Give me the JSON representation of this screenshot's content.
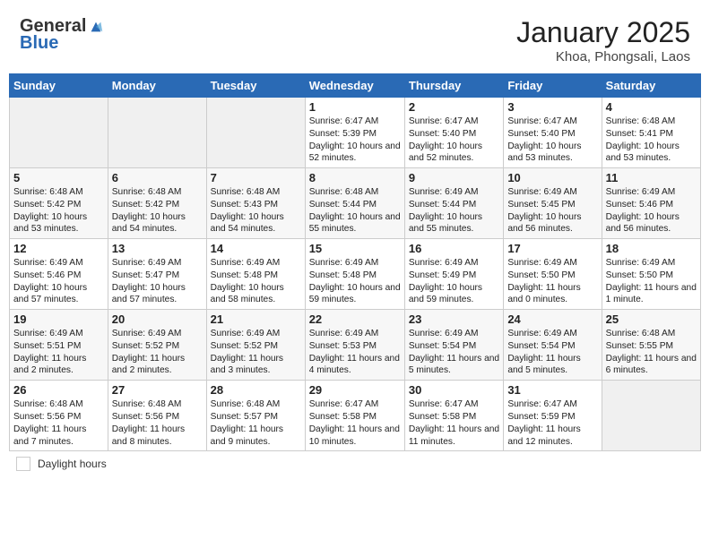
{
  "header": {
    "logo_general": "General",
    "logo_blue": "Blue",
    "month_title": "January 2025",
    "location": "Khoa, Phongsali, Laos"
  },
  "weekdays": [
    "Sunday",
    "Monday",
    "Tuesday",
    "Wednesday",
    "Thursday",
    "Friday",
    "Saturday"
  ],
  "weeks": [
    [
      {
        "day": "",
        "sunrise": "",
        "sunset": "",
        "daylight": "",
        "empty": true
      },
      {
        "day": "",
        "sunrise": "",
        "sunset": "",
        "daylight": "",
        "empty": true
      },
      {
        "day": "",
        "sunrise": "",
        "sunset": "",
        "daylight": "",
        "empty": true
      },
      {
        "day": "1",
        "sunrise": "Sunrise: 6:47 AM",
        "sunset": "Sunset: 5:39 PM",
        "daylight": "Daylight: 10 hours and 52 minutes."
      },
      {
        "day": "2",
        "sunrise": "Sunrise: 6:47 AM",
        "sunset": "Sunset: 5:40 PM",
        "daylight": "Daylight: 10 hours and 52 minutes."
      },
      {
        "day": "3",
        "sunrise": "Sunrise: 6:47 AM",
        "sunset": "Sunset: 5:40 PM",
        "daylight": "Daylight: 10 hours and 53 minutes."
      },
      {
        "day": "4",
        "sunrise": "Sunrise: 6:48 AM",
        "sunset": "Sunset: 5:41 PM",
        "daylight": "Daylight: 10 hours and 53 minutes."
      }
    ],
    [
      {
        "day": "5",
        "sunrise": "Sunrise: 6:48 AM",
        "sunset": "Sunset: 5:42 PM",
        "daylight": "Daylight: 10 hours and 53 minutes."
      },
      {
        "day": "6",
        "sunrise": "Sunrise: 6:48 AM",
        "sunset": "Sunset: 5:42 PM",
        "daylight": "Daylight: 10 hours and 54 minutes."
      },
      {
        "day": "7",
        "sunrise": "Sunrise: 6:48 AM",
        "sunset": "Sunset: 5:43 PM",
        "daylight": "Daylight: 10 hours and 54 minutes."
      },
      {
        "day": "8",
        "sunrise": "Sunrise: 6:48 AM",
        "sunset": "Sunset: 5:44 PM",
        "daylight": "Daylight: 10 hours and 55 minutes."
      },
      {
        "day": "9",
        "sunrise": "Sunrise: 6:49 AM",
        "sunset": "Sunset: 5:44 PM",
        "daylight": "Daylight: 10 hours and 55 minutes."
      },
      {
        "day": "10",
        "sunrise": "Sunrise: 6:49 AM",
        "sunset": "Sunset: 5:45 PM",
        "daylight": "Daylight: 10 hours and 56 minutes."
      },
      {
        "day": "11",
        "sunrise": "Sunrise: 6:49 AM",
        "sunset": "Sunset: 5:46 PM",
        "daylight": "Daylight: 10 hours and 56 minutes."
      }
    ],
    [
      {
        "day": "12",
        "sunrise": "Sunrise: 6:49 AM",
        "sunset": "Sunset: 5:46 PM",
        "daylight": "Daylight: 10 hours and 57 minutes."
      },
      {
        "day": "13",
        "sunrise": "Sunrise: 6:49 AM",
        "sunset": "Sunset: 5:47 PM",
        "daylight": "Daylight: 10 hours and 57 minutes."
      },
      {
        "day": "14",
        "sunrise": "Sunrise: 6:49 AM",
        "sunset": "Sunset: 5:48 PM",
        "daylight": "Daylight: 10 hours and 58 minutes."
      },
      {
        "day": "15",
        "sunrise": "Sunrise: 6:49 AM",
        "sunset": "Sunset: 5:48 PM",
        "daylight": "Daylight: 10 hours and 59 minutes."
      },
      {
        "day": "16",
        "sunrise": "Sunrise: 6:49 AM",
        "sunset": "Sunset: 5:49 PM",
        "daylight": "Daylight: 10 hours and 59 minutes."
      },
      {
        "day": "17",
        "sunrise": "Sunrise: 6:49 AM",
        "sunset": "Sunset: 5:50 PM",
        "daylight": "Daylight: 11 hours and 0 minutes."
      },
      {
        "day": "18",
        "sunrise": "Sunrise: 6:49 AM",
        "sunset": "Sunset: 5:50 PM",
        "daylight": "Daylight: 11 hours and 1 minute."
      }
    ],
    [
      {
        "day": "19",
        "sunrise": "Sunrise: 6:49 AM",
        "sunset": "Sunset: 5:51 PM",
        "daylight": "Daylight: 11 hours and 2 minutes."
      },
      {
        "day": "20",
        "sunrise": "Sunrise: 6:49 AM",
        "sunset": "Sunset: 5:52 PM",
        "daylight": "Daylight: 11 hours and 2 minutes."
      },
      {
        "day": "21",
        "sunrise": "Sunrise: 6:49 AM",
        "sunset": "Sunset: 5:52 PM",
        "daylight": "Daylight: 11 hours and 3 minutes."
      },
      {
        "day": "22",
        "sunrise": "Sunrise: 6:49 AM",
        "sunset": "Sunset: 5:53 PM",
        "daylight": "Daylight: 11 hours and 4 minutes."
      },
      {
        "day": "23",
        "sunrise": "Sunrise: 6:49 AM",
        "sunset": "Sunset: 5:54 PM",
        "daylight": "Daylight: 11 hours and 5 minutes."
      },
      {
        "day": "24",
        "sunrise": "Sunrise: 6:49 AM",
        "sunset": "Sunset: 5:54 PM",
        "daylight": "Daylight: 11 hours and 5 minutes."
      },
      {
        "day": "25",
        "sunrise": "Sunrise: 6:48 AM",
        "sunset": "Sunset: 5:55 PM",
        "daylight": "Daylight: 11 hours and 6 minutes."
      }
    ],
    [
      {
        "day": "26",
        "sunrise": "Sunrise: 6:48 AM",
        "sunset": "Sunset: 5:56 PM",
        "daylight": "Daylight: 11 hours and 7 minutes."
      },
      {
        "day": "27",
        "sunrise": "Sunrise: 6:48 AM",
        "sunset": "Sunset: 5:56 PM",
        "daylight": "Daylight: 11 hours and 8 minutes."
      },
      {
        "day": "28",
        "sunrise": "Sunrise: 6:48 AM",
        "sunset": "Sunset: 5:57 PM",
        "daylight": "Daylight: 11 hours and 9 minutes."
      },
      {
        "day": "29",
        "sunrise": "Sunrise: 6:47 AM",
        "sunset": "Sunset: 5:58 PM",
        "daylight": "Daylight: 11 hours and 10 minutes."
      },
      {
        "day": "30",
        "sunrise": "Sunrise: 6:47 AM",
        "sunset": "Sunset: 5:58 PM",
        "daylight": "Daylight: 11 hours and 11 minutes."
      },
      {
        "day": "31",
        "sunrise": "Sunrise: 6:47 AM",
        "sunset": "Sunset: 5:59 PM",
        "daylight": "Daylight: 11 hours and 12 minutes."
      },
      {
        "day": "",
        "sunrise": "",
        "sunset": "",
        "daylight": "",
        "empty": true
      }
    ]
  ],
  "footer": {
    "daylight_label": "Daylight hours"
  }
}
